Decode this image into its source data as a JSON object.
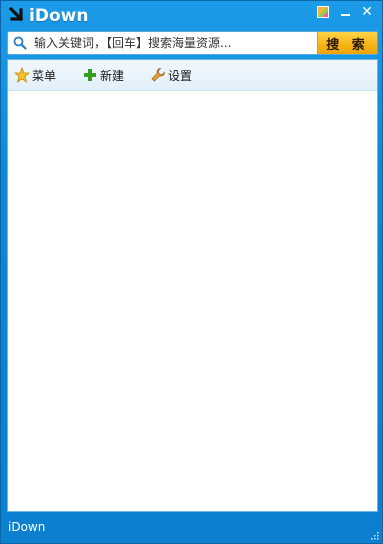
{
  "app": {
    "title": "iDown"
  },
  "titlebar": {
    "skin_button": "skin-icon",
    "minimize_button": "minimize-icon",
    "close_button": "close-icon"
  },
  "search": {
    "placeholder": "输入关键词，【回车】搜索海量资源...",
    "button_label": "搜 索"
  },
  "toolbar": {
    "items": [
      {
        "label": "菜单",
        "icon": "star-icon"
      },
      {
        "label": "新建",
        "icon": "plus-icon"
      },
      {
        "label": "设置",
        "icon": "wrench-icon"
      }
    ]
  },
  "statusbar": {
    "text": "iDown"
  },
  "colors": {
    "frame": "#1b9be8",
    "search_button": "#f7b519",
    "accent_green": "#3a9d23"
  }
}
